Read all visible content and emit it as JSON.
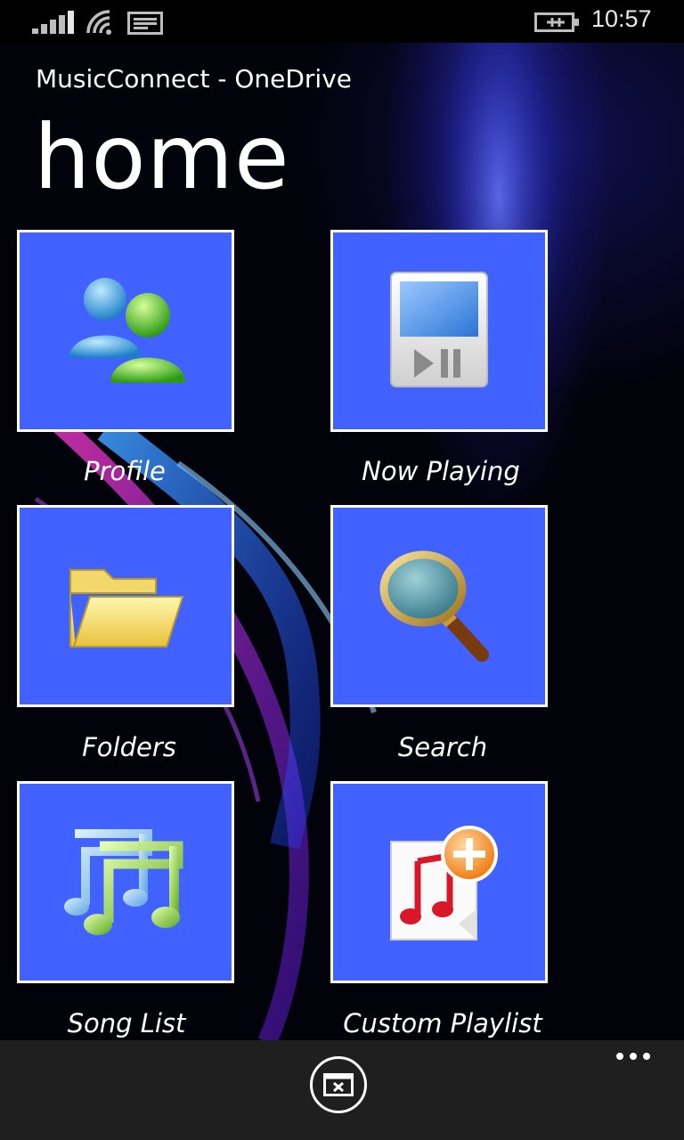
{
  "status_bar": {
    "time": "10:57",
    "icons": [
      "signal-icon",
      "wifi-icon",
      "message-icon",
      "battery-charging-icon"
    ]
  },
  "app": {
    "title": "MusicConnect - OneDrive",
    "page_title": "home"
  },
  "tiles": [
    {
      "label": "Profile",
      "icon": "profile-users-icon"
    },
    {
      "label": "Now Playing",
      "icon": "media-player-icon"
    },
    {
      "label": "Folders",
      "icon": "folder-icon"
    },
    {
      "label": "Search",
      "icon": "magnifier-icon"
    },
    {
      "label": "Song List",
      "icon": "music-notes-icon"
    },
    {
      "label": "Custom Playlist",
      "icon": "add-playlist-icon"
    }
  ],
  "app_bar": {
    "button_icon": "close-window-icon",
    "more_icon": "ellipsis-icon"
  },
  "colors": {
    "tile": "#4262ff",
    "app_bar": "#1f1f1f"
  }
}
